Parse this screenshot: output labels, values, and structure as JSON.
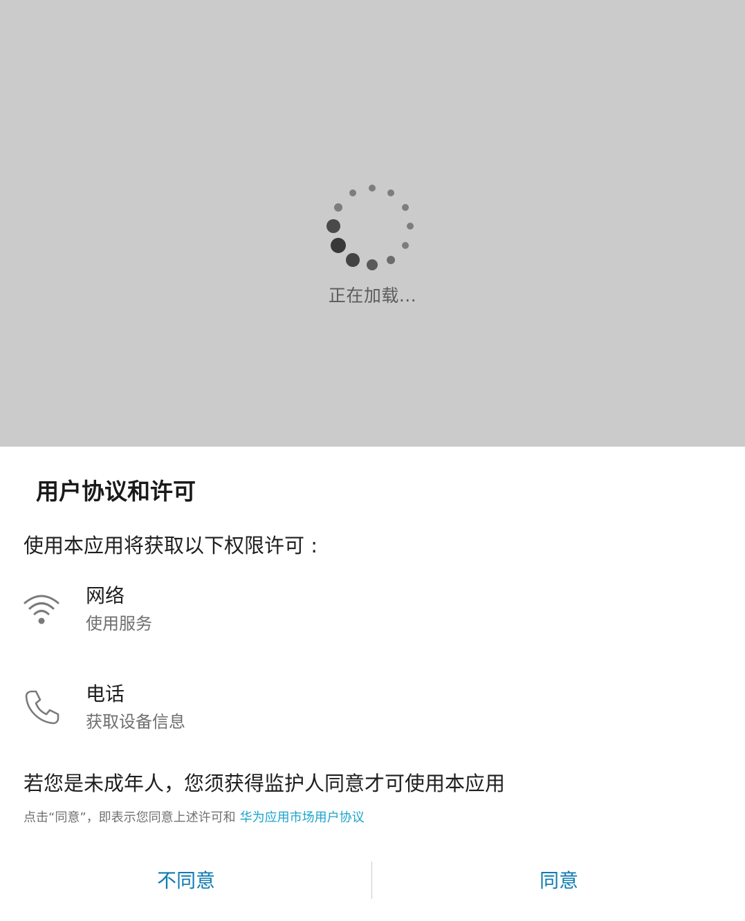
{
  "loading": {
    "text": "正在加载..."
  },
  "dialog": {
    "title": "用户协议和许可",
    "intro": "使用本应用将获取以下权限许可 :",
    "permissions": [
      {
        "icon": "wifi-icon",
        "name": "网络",
        "desc": "使用服务"
      },
      {
        "icon": "phone-icon",
        "name": "电话",
        "desc": "获取设备信息"
      }
    ],
    "minor_notice": "若您是未成年人，您须获得监护人同意才可使用本应用",
    "agree_note": "点击“同意”，即表示您同意上述许可和",
    "agreement_link": "华为应用市场用户协议",
    "buttons": {
      "disagree": "不同意",
      "agree": "同意"
    }
  },
  "colors": {
    "loading_bg": "#cbcbcb",
    "button_text": "#0e7bb0",
    "link": "#1aa3cc"
  }
}
